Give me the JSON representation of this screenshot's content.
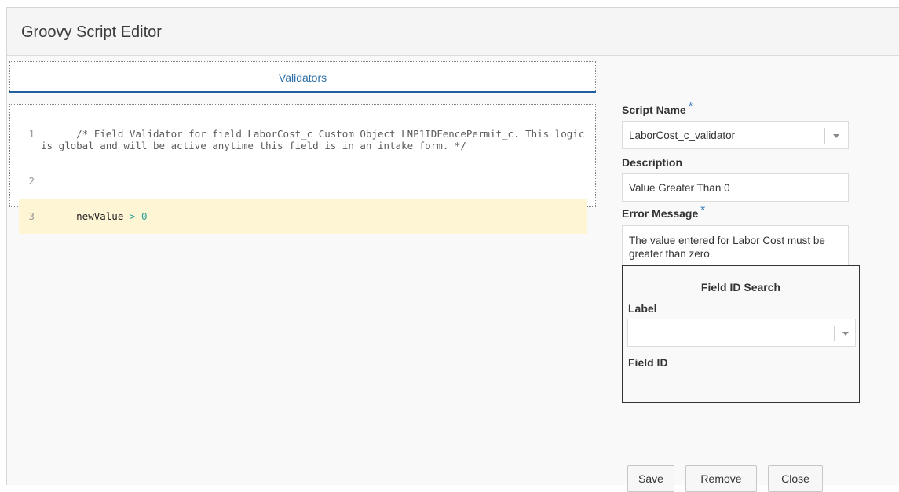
{
  "window": {
    "title": "Groovy Script Editor"
  },
  "tabs": [
    {
      "label": "Validators",
      "active": true
    }
  ],
  "editor": {
    "lines": [
      {
        "number": "1",
        "text": "/* Field Validator for field LaborCost_c Custom Object LNP1IDFencePermit_c. This logic is global and will be active anytime this field is in an intake form. */"
      },
      {
        "number": "2",
        "text": ""
      },
      {
        "number": "3",
        "text": "newValue > 0"
      }
    ]
  },
  "form": {
    "script_name": {
      "label": "Script Name",
      "required_marker": "*",
      "value": "LaborCost_c_validator"
    },
    "description": {
      "label": "Description",
      "value": "Value Greater Than 0"
    },
    "error_message": {
      "label": "Error Message",
      "required_marker": "*",
      "value": "The value entered for Labor Cost must be greater than zero."
    }
  },
  "field_id_search": {
    "title": "Field ID Search",
    "label_label": "Label",
    "label_value": "",
    "field_id_label": "Field ID"
  },
  "buttons": {
    "save": "Save",
    "remove": "Remove",
    "close": "Close"
  },
  "colors": {
    "accent": "#1e5f9f",
    "tab_text": "#2e6ea6",
    "required_marker": "#2e74b5",
    "active_line": "#fdf5d4"
  }
}
